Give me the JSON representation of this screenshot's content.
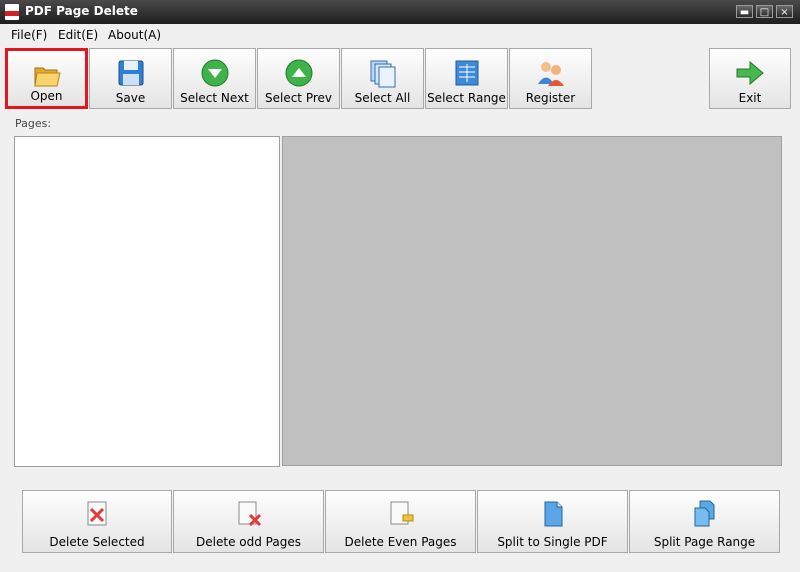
{
  "window": {
    "title": "PDF Page Delete",
    "minimize": "▬",
    "maximize": "□",
    "close": "×"
  },
  "menu": {
    "file": "File(F)",
    "edit": "Edit(E)",
    "about": "About(A)"
  },
  "toolbar": {
    "open": "Open",
    "save": "Save",
    "select_next": "Select Next",
    "select_prev": "Select Prev",
    "select_all": "Select All",
    "select_range": "Select Range",
    "register": "Register",
    "exit": "Exit",
    "selected_color": "#e3161d"
  },
  "pages_label": "Pages:",
  "bottom": {
    "delete_selected": "Delete Selected",
    "delete_odd": "Delete odd Pages",
    "delete_even": "Delete Even Pages",
    "split_single": "Split to Single PDF",
    "split_range": "Split Page Range"
  }
}
